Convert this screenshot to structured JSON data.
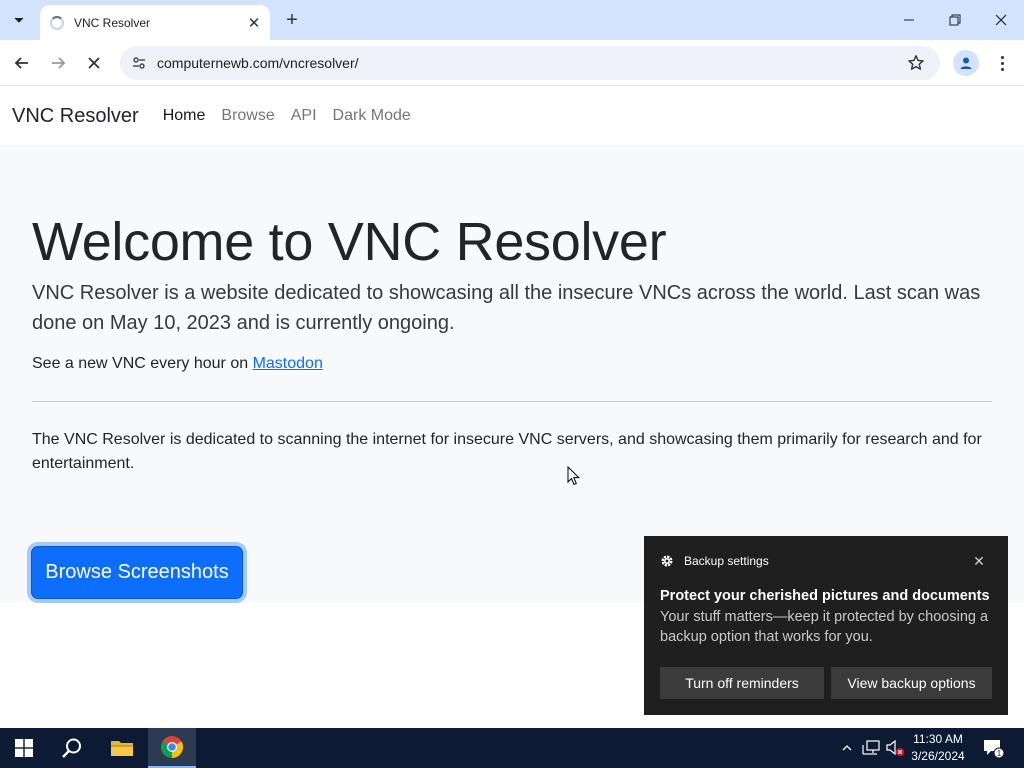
{
  "browser": {
    "tab_title": "VNC Resolver",
    "url": "computernewb.com/vncresolver/"
  },
  "site": {
    "brand": "VNC Resolver",
    "nav": [
      {
        "label": "Home",
        "active": true
      },
      {
        "label": "Browse",
        "active": false
      },
      {
        "label": "API",
        "active": false
      },
      {
        "label": "Dark Mode",
        "active": false
      }
    ],
    "heading": "Welcome to VNC Resolver",
    "lead": "VNC Resolver is a website dedicated to showcasing all the insecure VNCs across the world. Last scan was done on May 10, 2023 and is currently ongoing.",
    "mastodon_prefix": "See a new VNC every hour on",
    "mastodon_link": "Mastodon",
    "description": "The VNC Resolver is dedicated to scanning the internet for insecure VNC servers, and showcasing them primarily for research and for entertainment.",
    "button": "Browse Screenshots",
    "accent_color": "#0d6efd"
  },
  "toast": {
    "app": "Backup settings",
    "title": "Protect your cherished pictures and documents",
    "body": "Your stuff matters—keep it protected by choosing a backup option that works for you.",
    "btn_off": "Turn off reminders",
    "btn_view": "View backup options"
  },
  "taskbar": {
    "time": "11:30 AM",
    "date": "3/26/2024",
    "notification_count": "1"
  }
}
